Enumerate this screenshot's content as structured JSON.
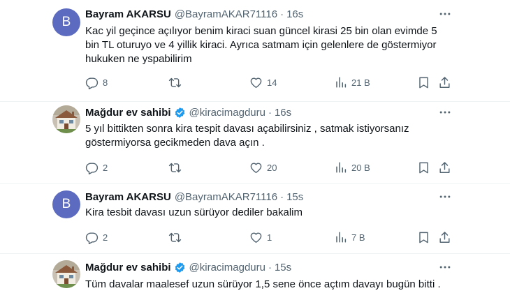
{
  "tweets": [
    {
      "avatar_letter": "B",
      "name": "Bayram AKARSU",
      "handle": "@BayramAKAR71116",
      "separator": "·",
      "time": "16s",
      "lines": [
        "Kac yil geçince açılıyor benim kiraci suan güncel kirasi 25 bin olan evimde 5",
        "bin TL oturuyo ve 4 yillik kiraci. Ayrıca satmam için gelenlere de göstermiyor",
        "hukuken ne yspabilirim"
      ],
      "replies": "8",
      "retweets": "",
      "likes": "14",
      "views": "21 B"
    },
    {
      "name": "Mağdur ev sahibi",
      "handle": "@kiracimagduru",
      "separator": "·",
      "time": "16s",
      "lines": [
        "5 yıl bittikten sonra kira tespit davası açabilirsiniz , satmak istiyorsanız",
        "göstermiyorsa gecikmeden dava açın ."
      ],
      "replies": "2",
      "retweets": "",
      "likes": "20",
      "views": "20 B"
    },
    {
      "avatar_letter": "B",
      "name": "Bayram AKARSU",
      "handle": "@BayramAKAR71116",
      "separator": "·",
      "time": "15s",
      "lines": [
        "Kira tesbit davası uzun sürüyor dediler bakalim"
      ],
      "replies": "2",
      "retweets": "",
      "likes": "1",
      "views": "7 B"
    },
    {
      "name": "Mağdur ev sahibi",
      "handle": "@kiracimagduru",
      "separator": "·",
      "time": "15s",
      "lines": [
        "Tüm davalar maalesef uzun sürüyor 1,5 sene önce açtım davayı bugün bitti ."
      ]
    }
  ],
  "colors": {
    "text_primary": "#0f1419",
    "text_secondary": "#536471",
    "verified_blue": "#1d9bf0",
    "letter_avatar": "#5c6bc0",
    "divider": "#eff3f4"
  },
  "icons": {
    "reply": "reply-icon",
    "retweet": "retweet-icon",
    "like": "like-icon",
    "views": "views-icon",
    "bookmark": "bookmark-icon",
    "share": "share-icon",
    "more": "more-icon",
    "verified": "verified-badge-icon"
  }
}
